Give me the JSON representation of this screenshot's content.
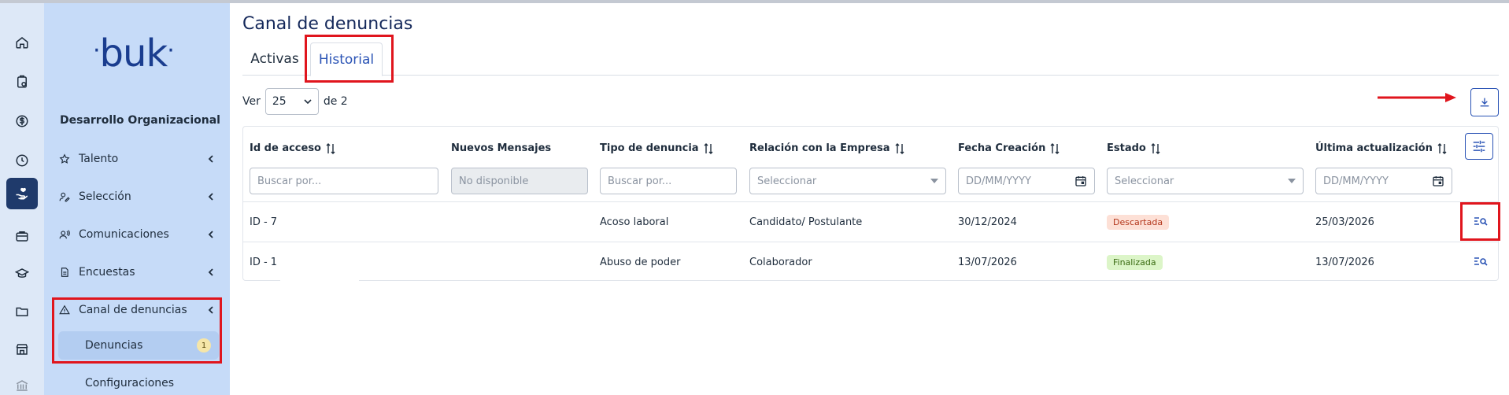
{
  "brand": {
    "logo_text": "buk",
    "logo_color": "#1a3d8f"
  },
  "colors": {
    "rail_bg": "#dde8f7",
    "sidebar_bg": "#c6dbf8",
    "accent": "#2a53b5",
    "annotation": "#e0151d"
  },
  "rail": {
    "icons": [
      "home-icon",
      "clipboard-clock-icon",
      "dollar-icon",
      "clock-icon",
      "hand-heart-icon",
      "briefcase-icon",
      "graduation-cap-icon",
      "folder-icon",
      "store-icon",
      "bank-icon"
    ],
    "active_index": 4
  },
  "sidebar": {
    "section_title": "Desarrollo Organizacional",
    "items": [
      {
        "label": "Talento",
        "icon": "star-icon"
      },
      {
        "label": "Selección",
        "icon": "user-pen-icon"
      },
      {
        "label": "Comunicaciones",
        "icon": "user-broadcast-icon"
      },
      {
        "label": "Encuestas",
        "icon": "document-icon"
      },
      {
        "label": "Canal de denuncias",
        "icon": "warning-icon"
      }
    ],
    "subitems": [
      {
        "label": "Denuncias",
        "badge": "1",
        "active": true
      },
      {
        "label": "Configuraciones"
      }
    ]
  },
  "main": {
    "title": "Canal de denuncias",
    "tabs": [
      {
        "label": "Activas"
      },
      {
        "label": "Historial",
        "active": true
      }
    ],
    "pagination": {
      "prefix": "Ver",
      "page_size": "25",
      "suffix": "de 2"
    }
  },
  "table": {
    "columns": [
      {
        "label": "Id de acceso",
        "sortable": true,
        "filter": "Buscar por..."
      },
      {
        "label": "Nuevos Mensajes",
        "sortable": false,
        "filter": "No disponible",
        "disabled": true
      },
      {
        "label": "Tipo de denuncia",
        "sortable": true,
        "filter": "Buscar por..."
      },
      {
        "label": "Relación con la Empresa",
        "sortable": true,
        "filter": "Seleccionar"
      },
      {
        "label": "Fecha Creación",
        "sortable": true,
        "filter": "DD/MM/YYYY"
      },
      {
        "label": "Estado",
        "sortable": true,
        "filter": "Seleccionar"
      },
      {
        "label": "Última actualización",
        "sortable": true,
        "filter": "DD/MM/YYYY"
      }
    ],
    "rows": [
      {
        "id": "ID - 7",
        "mensajes": "",
        "tipo": "Acoso laboral",
        "relacion": "Candidato/ Postulante",
        "fecha": "30/12/2024",
        "estado": "Descartada",
        "estado_bg": "#fde0d6",
        "estado_fg": "#b3361b",
        "actualizacion": "25/03/2026"
      },
      {
        "id": "ID - 1",
        "mensajes": "",
        "tipo": "Abuso de poder",
        "relacion": "Colaborador",
        "fecha": "13/07/2026",
        "estado": "Finalizada",
        "estado_bg": "#dcf5c8",
        "estado_fg": "#3a6b12",
        "actualizacion": "13/07/2026"
      }
    ]
  }
}
